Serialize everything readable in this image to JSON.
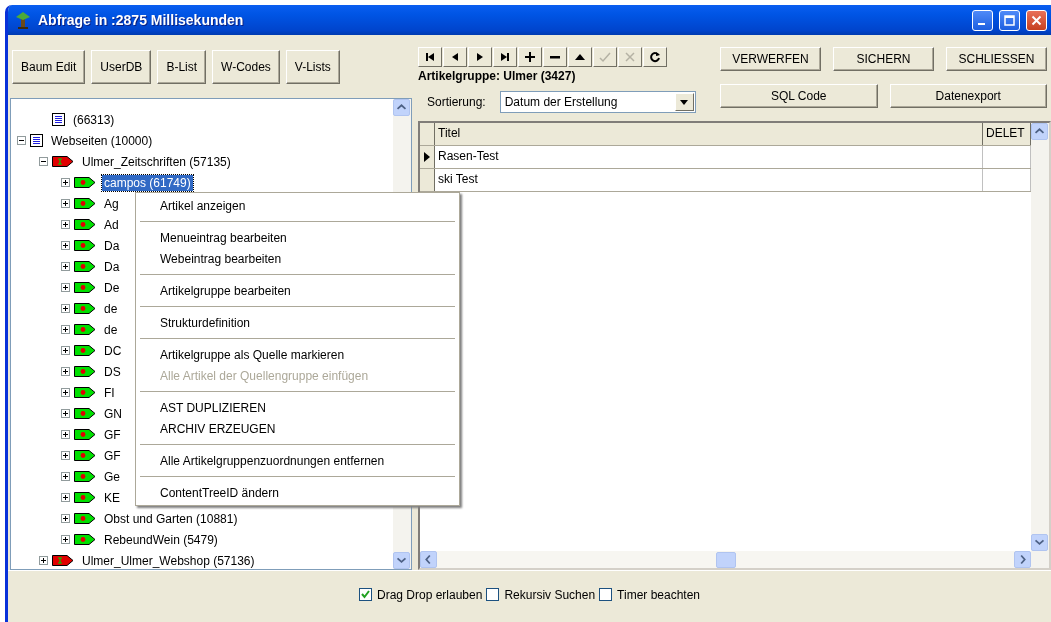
{
  "window": {
    "title": "Abfrage in :2875 Millisekunden"
  },
  "left_buttons": [
    "Baum Edit",
    "UserDB",
    "B-List",
    "W-Codes",
    "V-Lists"
  ],
  "tree": {
    "partial_branch": [
      {
        "label": "(66313)",
        "kind": "page"
      }
    ],
    "items": [
      {
        "label": "Webseiten (10000)",
        "expanded": true,
        "children": [
          {
            "label": "Ulmer_Zeitschriften (57135)",
            "expanded": true,
            "children": [
              {
                "label": "campos (61749)",
                "expanded": false,
                "selected": true
              },
              {
                "label": "Ag",
                "expanded": false,
                "selected": false
              },
              {
                "label": "Ad",
                "expanded": false,
                "selected": false
              },
              {
                "label": "Da",
                "expanded": false,
                "selected": false
              },
              {
                "label": "Da",
                "expanded": false,
                "selected": false
              },
              {
                "label": "De",
                "expanded": false,
                "selected": false
              },
              {
                "label": "de",
                "expanded": false,
                "selected": false
              },
              {
                "label": "de",
                "expanded": false,
                "selected": false
              },
              {
                "label": "DC",
                "expanded": false,
                "selected": false
              },
              {
                "label": "DS",
                "expanded": false,
                "selected": false
              },
              {
                "label": "FI",
                "expanded": false,
                "selected": false
              },
              {
                "label": "GN",
                "expanded": false,
                "selected": false
              },
              {
                "label": "GF",
                "expanded": false,
                "selected": false
              },
              {
                "label": "GF",
                "expanded": false,
                "selected": false
              },
              {
                "label": "Ge",
                "expanded": false,
                "selected": false
              },
              {
                "label": "KE",
                "expanded": false,
                "selected": false
              },
              {
                "label": "Obst und Garten (10881)",
                "expanded": false,
                "selected": false
              },
              {
                "label": "RebeundWein (5479)",
                "expanded": false,
                "selected": false
              }
            ]
          },
          {
            "label": "Ulmer_Ulmer_Webshop (57136)",
            "expanded": false
          }
        ]
      }
    ]
  },
  "nav_buttons": [
    {
      "kind": "first",
      "disabled": false
    },
    {
      "kind": "prior",
      "disabled": false
    },
    {
      "kind": "next",
      "disabled": false
    },
    {
      "kind": "last",
      "disabled": false
    },
    {
      "kind": "insert",
      "disabled": false
    },
    {
      "kind": "delete",
      "disabled": false
    },
    {
      "kind": "edit",
      "disabled": false
    },
    {
      "kind": "post",
      "disabled": true
    },
    {
      "kind": "cancel",
      "disabled": true
    },
    {
      "kind": "refresh",
      "disabled": false
    }
  ],
  "action_buttons": [
    "VERWERFEN",
    "SICHERN",
    "SCHLIESSEN"
  ],
  "group_label": "Artikelgruppe: Ulmer (3427)",
  "sort": {
    "label": "Sortierung:",
    "value": "Datum der Erstellung"
  },
  "secondary_buttons": [
    "SQL Code",
    "Datenexport"
  ],
  "grid": {
    "columns": [
      "Titel",
      "DELET"
    ],
    "rows": [
      {
        "title": "Rasen-Test",
        "current": true
      },
      {
        "title": "ski Test",
        "current": false
      }
    ]
  },
  "context_menu": [
    [
      {
        "label": "Artikel anzeigen",
        "disabled": false
      }
    ],
    [
      {
        "label": "Menueintrag bearbeiten",
        "disabled": false
      },
      {
        "label": "Webeintrag bearbeiten",
        "disabled": false
      }
    ],
    [
      {
        "label": "Artikelgruppe bearbeiten",
        "disabled": false
      }
    ],
    [
      {
        "label": "Strukturdefinition",
        "disabled": false
      }
    ],
    [
      {
        "label": "Artikelgruppe als Quelle markieren",
        "disabled": false
      },
      {
        "label": "Alle Artikel der Quellengruppe einfügen",
        "disabled": true
      }
    ],
    [
      {
        "label": "AST DUPLIZIEREN",
        "disabled": false
      },
      {
        "label": "ARCHIV ERZEUGEN",
        "disabled": false
      }
    ],
    [
      {
        "label": "Alle Artikelgruppenzuordnungen entfernen",
        "disabled": false
      }
    ],
    [
      {
        "label": "ContentTreeID ändern",
        "disabled": false
      }
    ]
  ],
  "options": [
    {
      "label": "Drag Drop erlauben",
      "checked": true
    },
    {
      "label": "Rekursiv Suchen",
      "checked": false
    },
    {
      "label": "Timer beachten",
      "checked": false
    }
  ]
}
